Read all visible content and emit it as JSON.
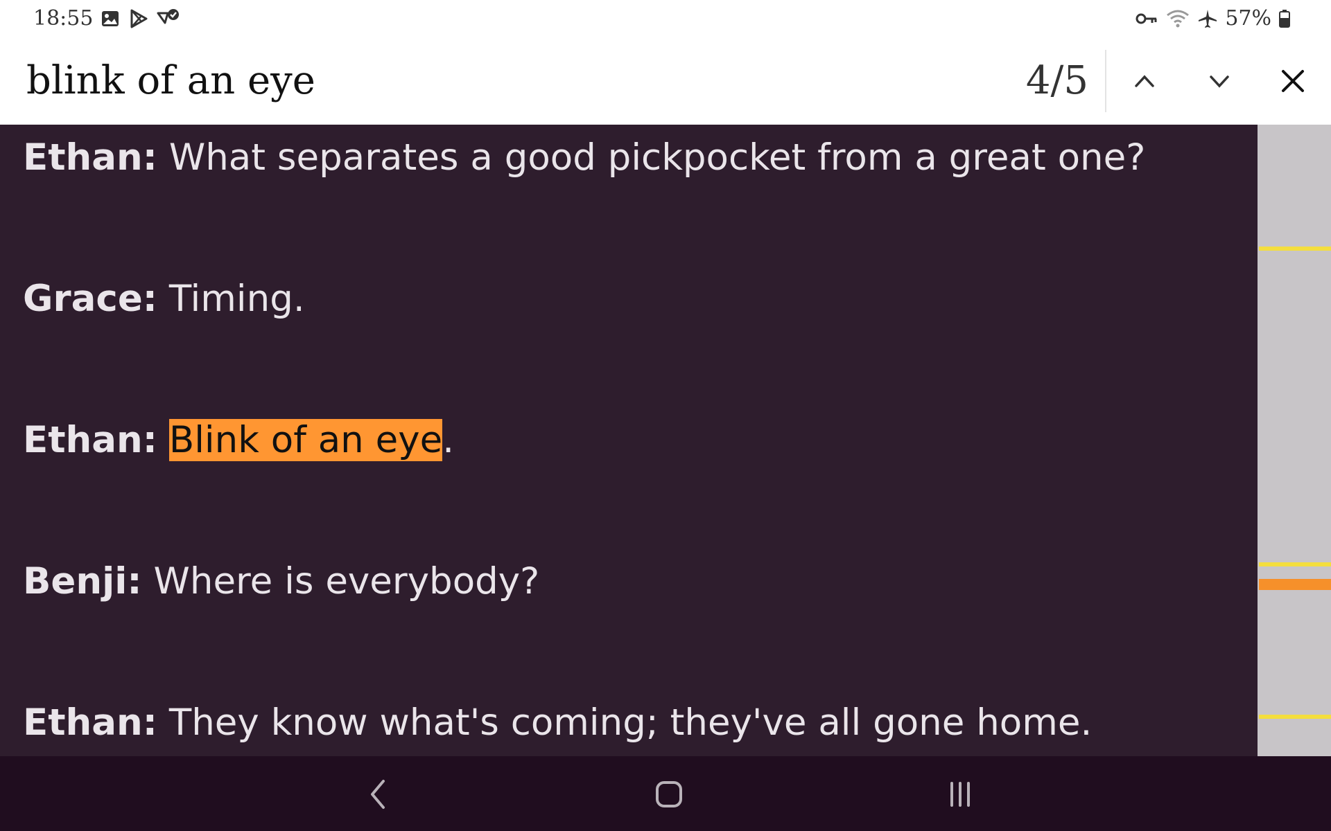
{
  "status_bar": {
    "time": "18:55",
    "left_icons": [
      "gallery-icon",
      "play-store-icon",
      "check-badge-icon"
    ],
    "right_icons": [
      "key-icon",
      "wifi-icon",
      "airplane-icon",
      "battery-icon"
    ],
    "battery": "57%"
  },
  "find_bar": {
    "query": "blink of an eye",
    "count": "4/5",
    "prev_icon": "chevron-up-icon",
    "next_icon": "chevron-down-icon",
    "close_icon": "close-icon"
  },
  "transcript": [
    {
      "speaker": "Ethan:",
      "text": " What separates a good pickpocket from a great one?"
    },
    {
      "speaker": "Grace:",
      "text": " Timing."
    },
    {
      "speaker": "Ethan:",
      "pre": " ",
      "match": "Blink of an eye",
      "post": "."
    },
    {
      "speaker": "Benji:",
      "text": " Where is everybody?"
    },
    {
      "speaker": "Ethan:",
      "text": " They know what's coming; they've all gone home."
    }
  ],
  "colors": {
    "background": "#2e1d2d",
    "current_match": "#ff9632",
    "other_match_marker": "#f4de3e",
    "nav_bar": "#200d1f"
  },
  "nav_bar": {
    "buttons": [
      "back-icon",
      "home-icon",
      "recents-icon"
    ]
  }
}
